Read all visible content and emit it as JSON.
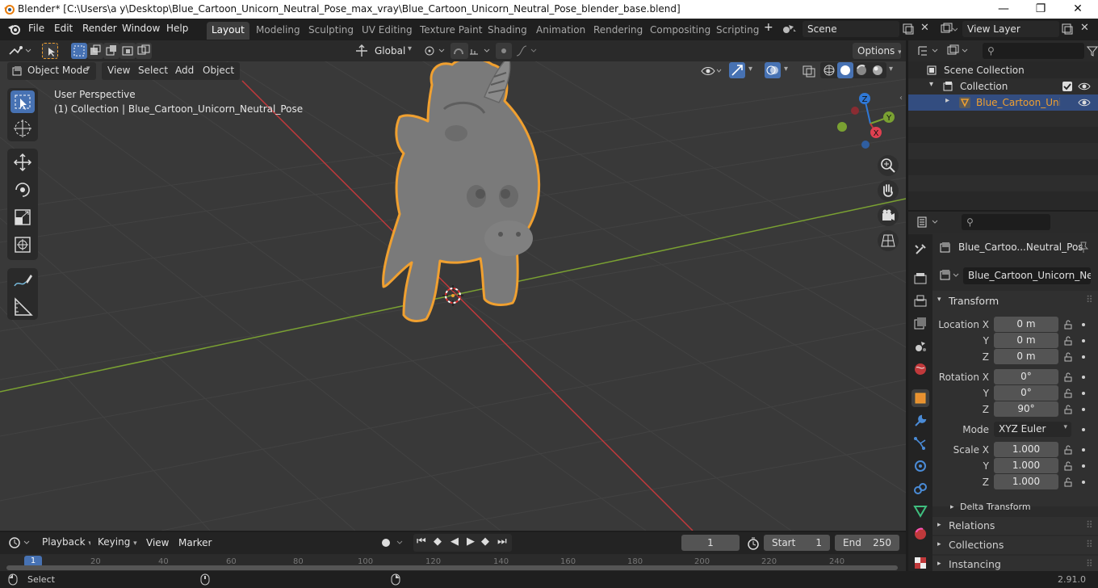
{
  "window": {
    "title": "Blender* [C:\\Users\\a y\\Desktop\\Blue_Cartoon_Unicorn_Neutral_Pose_max_vray\\Blue_Cartoon_Unicorn_Neutral_Pose_blender_base.blend]",
    "minimize": "—",
    "maximize": "❐",
    "close": "✕"
  },
  "menu": [
    "File",
    "Edit",
    "Render",
    "Window",
    "Help"
  ],
  "workspaces": [
    "Layout",
    "Modeling",
    "Sculpting",
    "UV Editing",
    "Texture Paint",
    "Shading",
    "Animation",
    "Rendering",
    "Compositing",
    "Scripting"
  ],
  "active_workspace": "Layout",
  "add_workspace": "+",
  "scene": {
    "name": "Scene",
    "view_layer": "View Layer"
  },
  "viewport": {
    "transform_orientation": "Global",
    "options_label": "Options",
    "mode": "Object Mode",
    "header_menus": [
      "View",
      "Select",
      "Add",
      "Object"
    ],
    "perspective_label": "User Perspective",
    "collection_info": "(1) Collection | Blue_Cartoon_Unicorn_Neutral_Pose",
    "gizmo": {
      "x": "X",
      "y": "Y",
      "z": "Z"
    }
  },
  "outliner": {
    "search_placeholder": "",
    "rows": [
      {
        "label": "Scene Collection"
      },
      {
        "label": "Collection"
      },
      {
        "label": "Blue_Cartoon_Unicor"
      }
    ]
  },
  "properties": {
    "object_name": "Blue_Cartoo...Neutral_Pos",
    "data_name": "Blue_Cartoon_Unicorn_Neut...",
    "transform_title": "Transform",
    "location": {
      "label_x": "Location X",
      "label_y": "Y",
      "label_z": "Z",
      "x": "0 m",
      "y": "0 m",
      "z": "0 m"
    },
    "rotation": {
      "label_x": "Rotation X",
      "label_y": "Y",
      "label_z": "Z",
      "x": "0°",
      "y": "0°",
      "z": "90°"
    },
    "mode_label": "Mode",
    "mode_value": "XYZ Euler",
    "scale": {
      "label_x": "Scale X",
      "label_y": "Y",
      "label_z": "Z",
      "x": "1.000",
      "y": "1.000",
      "z": "1.000"
    },
    "delta_transform": "Delta Transform",
    "sections": [
      "Relations",
      "Collections",
      "Instancing"
    ]
  },
  "timeline": {
    "menus": [
      "Playback",
      "Keying",
      "View",
      "Marker"
    ],
    "current_frame": "1",
    "start_label": "Start",
    "start_value": "1",
    "end_label": "End",
    "end_value": "250",
    "ticks": [
      "1",
      "20",
      "40",
      "60",
      "80",
      "100",
      "120",
      "140",
      "160",
      "180",
      "200",
      "220",
      "240"
    ]
  },
  "status": {
    "left": "Select",
    "version": "2.91.0"
  },
  "colors": {
    "accent": "#4772b3",
    "selection_outline": "#f0a030",
    "x_axis": "#c0393b",
    "y_axis": "#7aa132",
    "z_axis": "#2f78d6"
  }
}
